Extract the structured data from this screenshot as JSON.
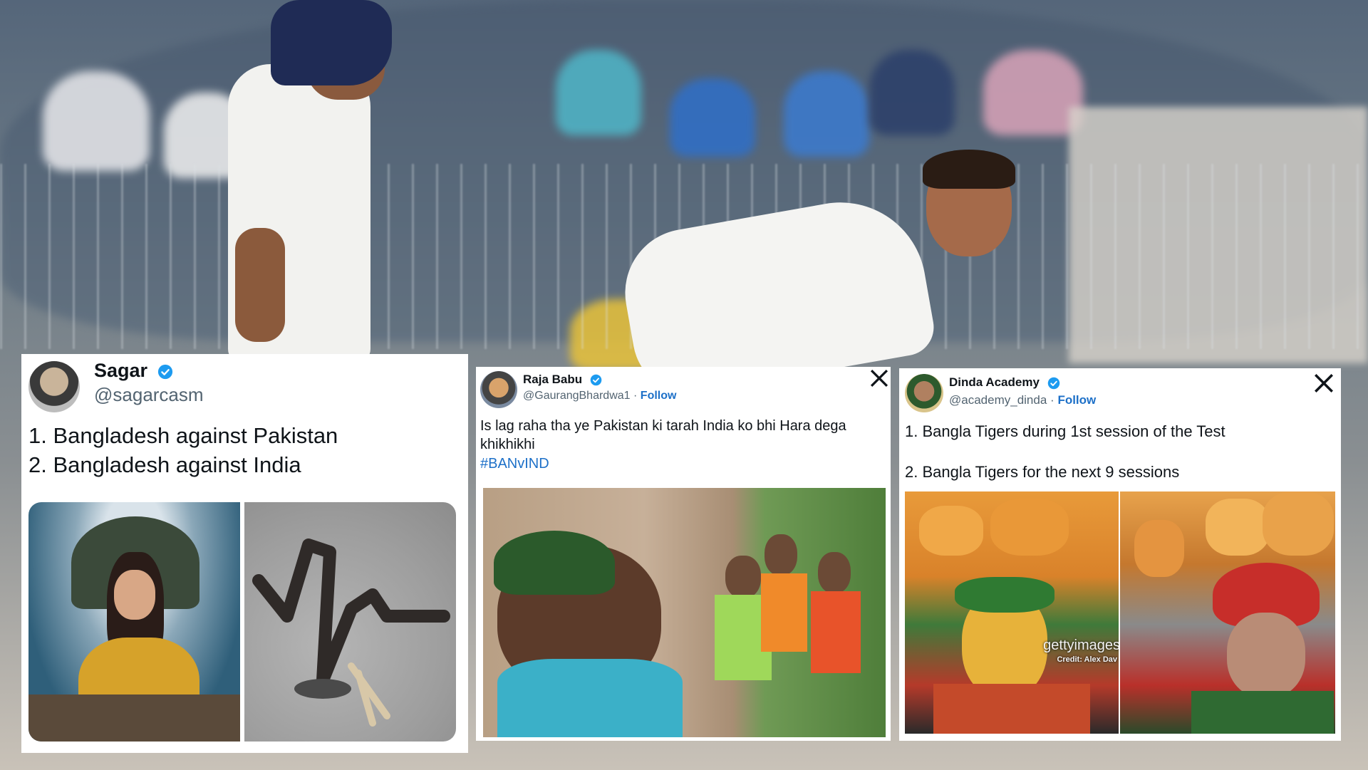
{
  "tweets": [
    {
      "name": "Sagar",
      "handle": "@sagarcasm",
      "verified": true,
      "lines": [
        "1. Bangladesh against Pakistan",
        "2. Bangladesh against India"
      ],
      "media_count": 2
    },
    {
      "name": "Raja Babu",
      "handle": "@GaurangBhardwa1",
      "verified": true,
      "follow_label": "Follow",
      "separator": "·",
      "lines": [
        "Is lag raha tha ye Pakistan ki tarah India ko bhi Hara dega",
        "khikhikhi"
      ],
      "hashtag": "#BANvIND",
      "platform_icon": "x-logo-icon",
      "media_count": 1
    },
    {
      "name": "Dinda Academy",
      "handle": "@academy_dinda",
      "verified": true,
      "follow_label": "Follow",
      "separator": "·",
      "lines": [
        "1. Bangla Tigers during 1st session of the Test",
        "2. Bangla Tigers for the next 9 sessions"
      ],
      "platform_icon": "x-logo-icon",
      "media_count": 2,
      "watermark": "gettyimages",
      "credit": "Credit: Alex Dav"
    }
  ],
  "colors": {
    "link": "#1d70c8",
    "verified": "#1d9bf0",
    "text": "#0f1419",
    "muted": "#536471"
  },
  "icons": {
    "verified": "verified-badge-icon",
    "platform": "x-logo-icon"
  }
}
